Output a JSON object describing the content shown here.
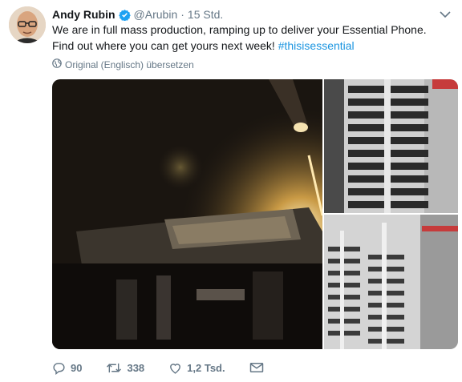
{
  "tweet": {
    "author_name": "Andy Rubin",
    "handle": "@Arubin",
    "separator": "·",
    "time": "15 Std.",
    "text_main": "We are in full mass production, ramping up to deliver your Essential Phone. Find out where you can get yours next week! ",
    "hashtag": "#thisisessential",
    "translate_label": "Original (Englisch) übersetzen",
    "icons": [
      "verified-badge-icon",
      "chevron-down-icon",
      "globe-icon",
      "reply-icon",
      "retweet-icon",
      "like-icon",
      "direct-message-icon"
    ]
  },
  "actions": {
    "reply_count": "90",
    "retweet_count": "338",
    "like_count": "1,2 Tsd."
  },
  "colors": {
    "accent": "#1b95e0",
    "secondary_text": "#657786",
    "primary_text": "#14171a"
  }
}
